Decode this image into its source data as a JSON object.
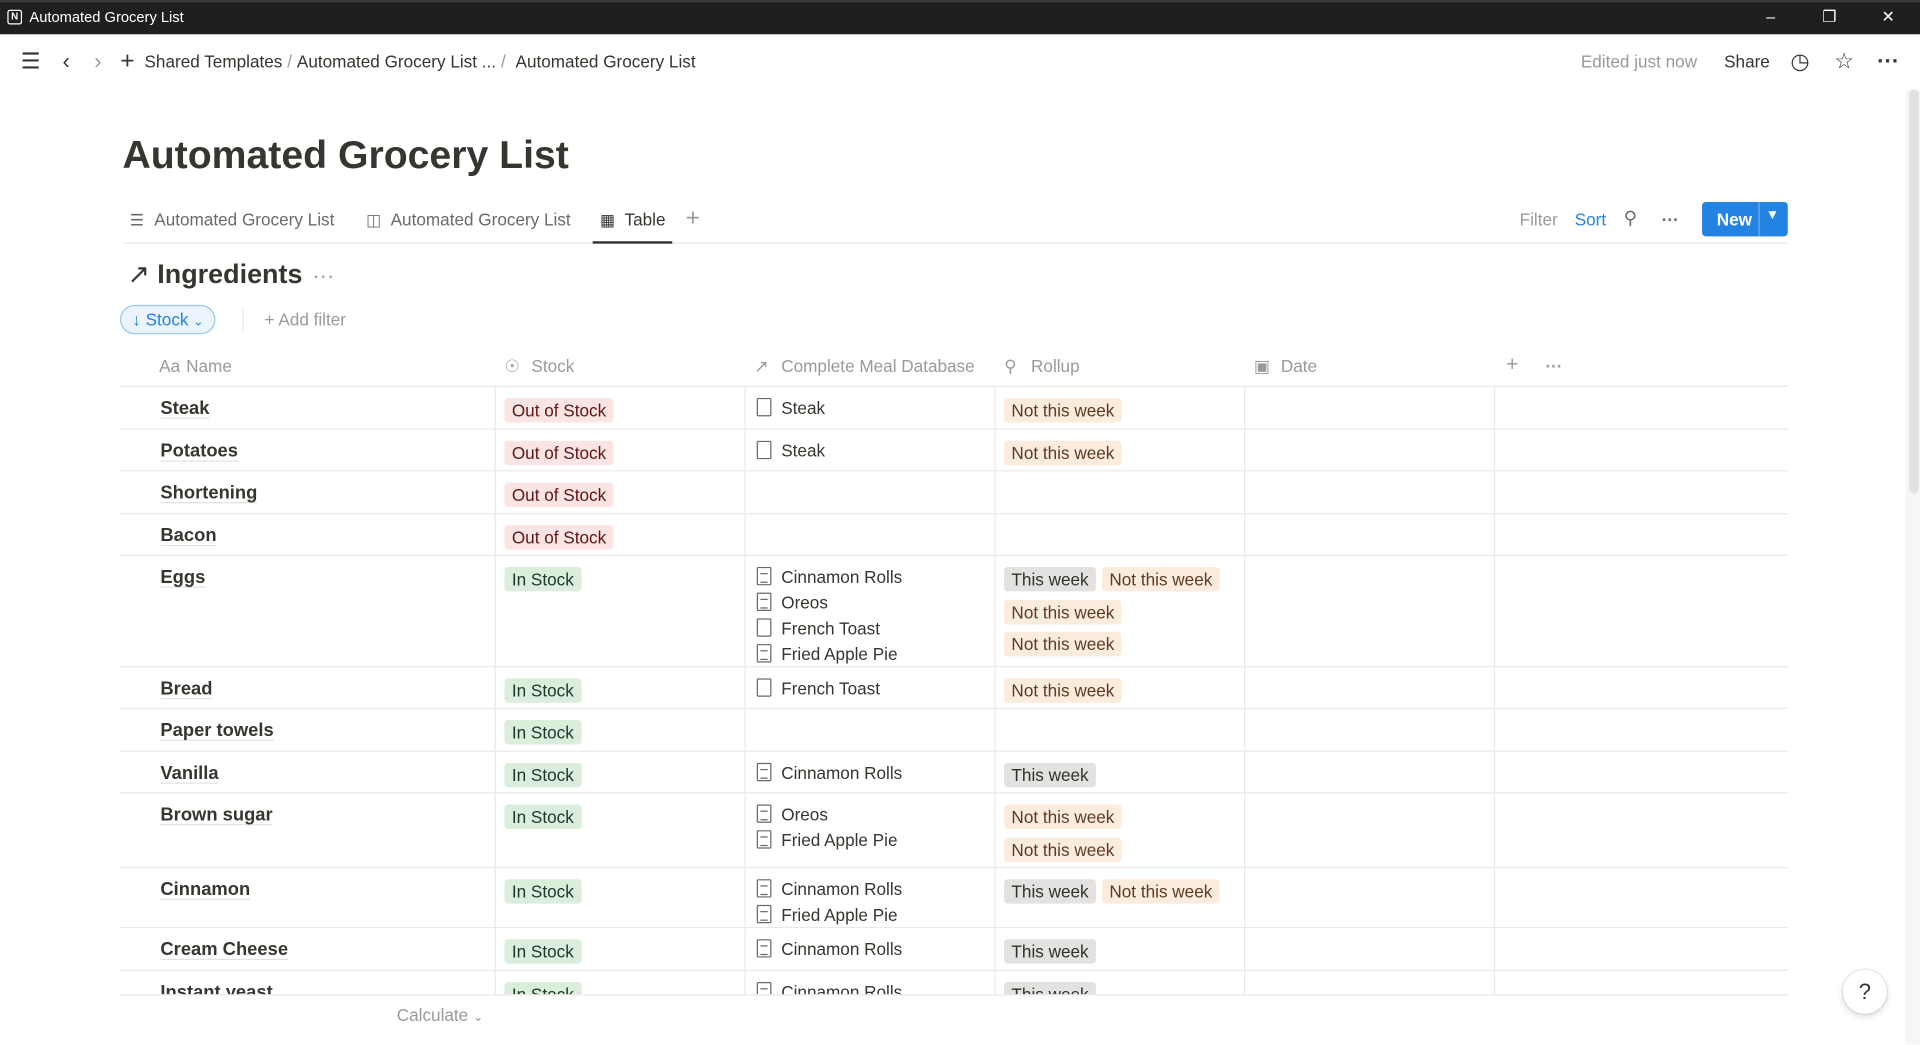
{
  "window": {
    "title": "Automated Grocery List"
  },
  "breadcrumb": [
    "Shared Templates",
    "Automated Grocery List ...",
    "Automated Grocery List"
  ],
  "topbar": {
    "edited": "Edited just now",
    "share": "Share"
  },
  "page": {
    "title": "Automated Grocery List"
  },
  "views": {
    "tabs": [
      {
        "label": "Automated Grocery List",
        "icon": "list-icon"
      },
      {
        "label": "Automated Grocery List",
        "icon": "board-icon"
      },
      {
        "label": "Table",
        "icon": "table-icon",
        "active": true
      }
    ],
    "filter": "Filter",
    "sort": "Sort",
    "new": "New"
  },
  "database": {
    "title": "Ingredients",
    "sort_pill": "Stock",
    "add_filter": "Add filter",
    "columns": [
      "Name",
      "Stock",
      "Complete Meal Database",
      "Rollup",
      "Date"
    ],
    "rows": [
      {
        "name": "Steak",
        "stock": "Out of Stock",
        "meals": [
          "Steak"
        ],
        "rollup": [
          "Not this week"
        ]
      },
      {
        "name": "Potatoes",
        "stock": "Out of Stock",
        "meals": [
          "Steak"
        ],
        "rollup": [
          "Not this week"
        ]
      },
      {
        "name": "Shortening",
        "stock": "Out of Stock",
        "meals": [],
        "rollup": []
      },
      {
        "name": "Bacon",
        "stock": "Out of Stock",
        "meals": [],
        "rollup": []
      },
      {
        "name": "Eggs",
        "stock": "In Stock",
        "meals": [
          "Cinnamon Rolls",
          "Oreos",
          "French Toast",
          "Fried Apple Pie"
        ],
        "rollup": [
          "This week",
          "Not this week",
          "Not this week",
          "Not this week"
        ]
      },
      {
        "name": "Bread",
        "stock": "In Stock",
        "meals": [
          "French Toast"
        ],
        "rollup": [
          "Not this week"
        ]
      },
      {
        "name": "Paper towels",
        "stock": "In Stock",
        "meals": [],
        "rollup": []
      },
      {
        "name": "Vanilla",
        "stock": "In Stock",
        "meals": [
          "Cinnamon Rolls"
        ],
        "rollup": [
          "This week"
        ]
      },
      {
        "name": "Brown sugar",
        "stock": "In Stock",
        "meals": [
          "Oreos",
          "Fried Apple Pie"
        ],
        "rollup": [
          "Not this week",
          "Not this week"
        ]
      },
      {
        "name": "Cinnamon",
        "stock": "In Stock",
        "meals": [
          "Cinnamon Rolls",
          "Fried Apple Pie"
        ],
        "rollup": [
          "This week",
          "Not this week"
        ]
      },
      {
        "name": "Cream Cheese",
        "stock": "In Stock",
        "meals": [
          "Cinnamon Rolls"
        ],
        "rollup": [
          "This week"
        ]
      },
      {
        "name": "Instant yeast",
        "stock": "In Stock",
        "meals": [
          "Cinnamon Rolls"
        ],
        "rollup": [
          "This week"
        ]
      }
    ],
    "footer": "Calculate"
  },
  "help": "?"
}
